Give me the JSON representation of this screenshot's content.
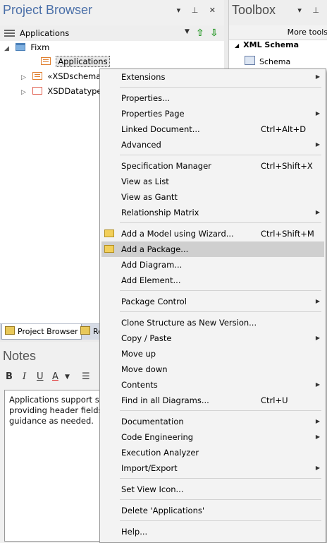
{
  "project_browser": {
    "title": "Project Browser",
    "controls": "▾ ⊥ ✕",
    "path": "Applications",
    "tree": [
      {
        "label": "Fixm",
        "type": "folder",
        "twisty": "◢"
      },
      {
        "label": "Applications",
        "type": "schema",
        "twisty": ""
      },
      {
        "label": "«XSDschema",
        "type": "schema",
        "twisty": "▷"
      },
      {
        "label": "XSDDatatype",
        "type": "datatype",
        "twisty": "▷"
      }
    ],
    "tabs": {
      "project_browser": "Project Browser",
      "re": "Re"
    }
  },
  "notes": {
    "title": "Notes",
    "toolbar": {
      "bold": "B",
      "italic": "I",
      "underline": "U",
      "color": "A",
      "list": "☰"
    },
    "lines": [
      "Applications support sp",
      "providing header fields",
      "guidance as needed."
    ]
  },
  "toolbox": {
    "title": "Toolbox",
    "controls": "▾ ⊥",
    "more_tools": "More tools",
    "section": "XML Schema",
    "item": "Schema"
  },
  "context_menu": {
    "items": [
      {
        "label": "Extensions",
        "shortcut": "",
        "submenu": true
      },
      {
        "label": "Properties...",
        "shortcut": "",
        "submenu": false
      },
      {
        "label": "Properties Page",
        "shortcut": "",
        "submenu": true
      },
      {
        "label": "Linked Document...",
        "shortcut": "Ctrl+Alt+D",
        "submenu": false
      },
      {
        "label": "Advanced",
        "shortcut": "",
        "submenu": true
      },
      {
        "label": "Specification Manager",
        "shortcut": "Ctrl+Shift+X",
        "submenu": false
      },
      {
        "label": "View as List",
        "shortcut": "",
        "submenu": false
      },
      {
        "label": "View as Gantt",
        "shortcut": "",
        "submenu": false
      },
      {
        "label": "Relationship Matrix",
        "shortcut": "",
        "submenu": true
      },
      {
        "label": "Add a Model using Wizard...",
        "shortcut": "Ctrl+Shift+M",
        "submenu": false
      },
      {
        "label": "Add a Package...",
        "shortcut": "",
        "submenu": false
      },
      {
        "label": "Add Diagram...",
        "shortcut": "",
        "submenu": false
      },
      {
        "label": "Add Element...",
        "shortcut": "",
        "submenu": false
      },
      {
        "label": "Package Control",
        "shortcut": "",
        "submenu": true
      },
      {
        "label": "Clone Structure as New Version...",
        "shortcut": "",
        "submenu": false
      },
      {
        "label": "Copy / Paste",
        "shortcut": "",
        "submenu": true
      },
      {
        "label": "Move up",
        "shortcut": "",
        "submenu": false
      },
      {
        "label": "Move down",
        "shortcut": "",
        "submenu": false
      },
      {
        "label": "Contents",
        "shortcut": "",
        "submenu": true
      },
      {
        "label": "Find in all Diagrams...",
        "shortcut": "Ctrl+U",
        "submenu": false
      },
      {
        "label": "Documentation",
        "shortcut": "",
        "submenu": true
      },
      {
        "label": "Code Engineering",
        "shortcut": "",
        "submenu": true
      },
      {
        "label": "Execution Analyzer",
        "shortcut": "",
        "submenu": false
      },
      {
        "label": "Import/Export",
        "shortcut": "",
        "submenu": true
      },
      {
        "label": "Set View Icon...",
        "shortcut": "",
        "submenu": false
      },
      {
        "label": "Delete 'Applications'",
        "shortcut": "",
        "submenu": false
      },
      {
        "label": "Help...",
        "shortcut": "",
        "submenu": false
      }
    ]
  }
}
